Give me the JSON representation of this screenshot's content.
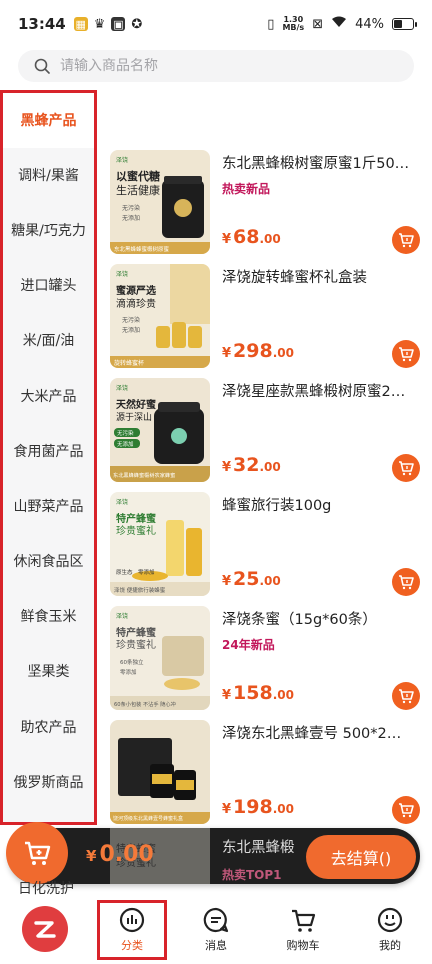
{
  "status_bar": {
    "time": "13:44",
    "net_speed_value": "1.30",
    "net_speed_unit": "MB/s",
    "battery": "44%"
  },
  "search": {
    "placeholder": "请输入商品名称"
  },
  "sidebar": {
    "items": [
      {
        "label": "黑蜂产品",
        "active": true
      },
      {
        "label": "调料/果酱",
        "active": false
      },
      {
        "label": "糖果/巧克力",
        "active": false
      },
      {
        "label": "进口罐头",
        "active": false
      },
      {
        "label": "米/面/油",
        "active": false
      },
      {
        "label": "大米产品",
        "active": false
      },
      {
        "label": "食用菌产品",
        "active": false
      },
      {
        "label": "山野菜产品",
        "active": false
      },
      {
        "label": "休闲食品区",
        "active": false
      },
      {
        "label": "鲜食玉米",
        "active": false
      },
      {
        "label": "坚果类",
        "active": false
      },
      {
        "label": "助农产品",
        "active": false
      },
      {
        "label": "俄罗斯商品",
        "active": false
      }
    ],
    "peek_label": "日化洗护"
  },
  "products": [
    {
      "name": "东北黑蜂椴树蜜原蜜1斤50…",
      "tag": "热卖新品",
      "currency": "¥",
      "price_int": "68",
      "price_dec": ".00",
      "thumb": {
        "brand": "泽饶",
        "line1": "以蜜代糖",
        "line2": "生活健康",
        "b1": "无污染",
        "b2": "无添加",
        "footer": "东北黑蜂蜂蜜椴树原蜜",
        "bg": "#efe6d2",
        "jar": "#1d1d1d"
      }
    },
    {
      "name": "泽饶旋转蜂蜜杯礼盒装",
      "tag": "",
      "currency": "¥",
      "price_int": "298",
      "price_dec": ".00",
      "thumb": {
        "brand": "泽饶",
        "line1": "蜜源严选",
        "line2": "滴滴珍贵",
        "b1": "无污染",
        "b2": "无添加",
        "footer": "旋转蜂蜜杯",
        "bg": "#f1ead9",
        "jar": "#e4b73c"
      }
    },
    {
      "name": "泽饶星座款黑蜂椴树原蜜2…",
      "tag": "",
      "currency": "¥",
      "price_int": "32",
      "price_dec": ".00",
      "thumb": {
        "brand": "泽饶",
        "line1": "天然好蜜",
        "line2": "源于深山",
        "b1": "无污染",
        "b2": "无添加",
        "footer": "东北黑蜂蜂蜜椴树农家蜂蜜",
        "bg": "#eee5d3",
        "jar": "#1d1d1d"
      }
    },
    {
      "name": "蜂蜜旅行装100g",
      "tag": "",
      "currency": "¥",
      "price_int": "25",
      "price_dec": ".00",
      "thumb": {
        "brand": "泽饶",
        "line1": "特产蜂蜜",
        "line2": "珍贵蜜礼",
        "b1": "原生态",
        "b2": "零添加",
        "footer": "泽饶 便捷旅行装蜂蜜",
        "bg": "#f3efe3",
        "jar": "#e9b52f"
      }
    },
    {
      "name": "泽饶条蜜（15g*60条）",
      "tag": "24年新品",
      "currency": "¥",
      "price_int": "158",
      "price_dec": ".00",
      "thumb": {
        "brand": "泽饶",
        "line1": "特产蜂蜜",
        "line2": "珍贵蜜礼",
        "b1": "60条独立",
        "b2": "零添加",
        "footer": "60条小包装 不沾手 随心冲",
        "bg": "#f2ecdf",
        "jar": "#d9c9a4"
      }
    },
    {
      "name": "泽饶东北黑蜂壹号 500*2…",
      "tag": "",
      "currency": "¥",
      "price_int": "198",
      "price_dec": ".00",
      "thumb": {
        "brand": "泽饶",
        "line1": "",
        "line2": "",
        "b1": "",
        "b2": "",
        "footer": "饶河顶级东北黑蜂壹号蜂蜜礼盒",
        "bg": "#ece3cf",
        "jar": "#222222"
      }
    }
  ],
  "peek_product": {
    "name": "东北黑蜂椴",
    "tag": "热卖TOP1",
    "thumb_line1": "特产蜂蜜",
    "thumb_line2": "珍贵蜜礼"
  },
  "cart_bar": {
    "currency": "¥",
    "total": "0.00",
    "checkout_label": "去结算()"
  },
  "tabbar": {
    "items": [
      {
        "label": "分类",
        "icon": "chart-icon",
        "active": true
      },
      {
        "label": "消息",
        "icon": "message-icon",
        "active": false
      },
      {
        "label": "购物车",
        "icon": "cart-icon",
        "active": false
      },
      {
        "label": "我的",
        "icon": "smile-icon",
        "active": false
      }
    ]
  },
  "colors": {
    "accent": "#e8541e",
    "highlight_border": "#d8232a",
    "cart_button": "#f06020",
    "tag": "#c2185b"
  }
}
